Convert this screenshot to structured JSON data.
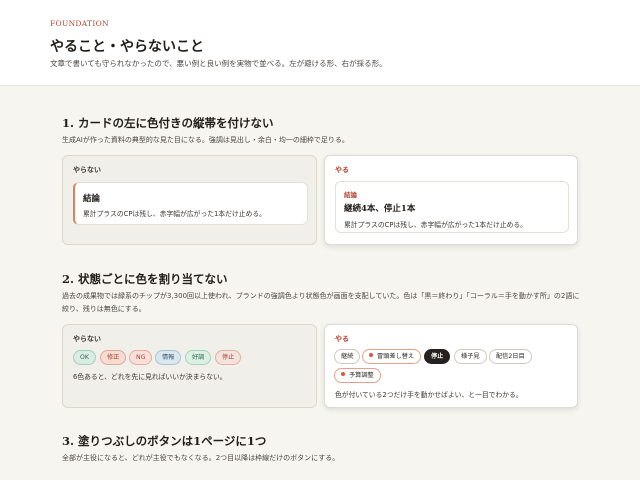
{
  "header": {
    "eyebrow": "FOUNDATION",
    "title": "やること・やらないこと",
    "description": "文章で書いても守られなかったので、悪い例と良い例を実物で並べる。左が避ける形、右が採る形。"
  },
  "sections": [
    {
      "title": "1. カードの左に色付きの縦帯を付けない",
      "description": "生成AIが作った資料の典型的な見た目になる。強調は見出し・余白・均一の細枠で足りる。",
      "bad": {
        "label": "やらない",
        "card_title": "結論",
        "card_body": "累計プラスのCPは残し、赤字幅が広がった1本だけ止める。"
      },
      "good": {
        "label": "やる",
        "kicker": "結論",
        "card_title": "継続4本、停止1本",
        "card_body": "累計プラスのCPは残し、赤字幅が広がった1本だけ止める。"
      }
    },
    {
      "title": "2. 状態ごとに色を割り当てない",
      "description": "過去の成果物では緑系のチップが3,300回以上使われ、ブランドの強調色より状態色が画面を支配していた。色は「黒＝終わり」「コーラル＝手を動かす所」の2語に絞り、残りは無色にする。",
      "bad": {
        "label": "やらない",
        "chips": [
          {
            "text": "OK",
            "bg": "#d9ece3",
            "border": "#a7cdb9",
            "color": "#2d6a4f"
          },
          {
            "text": "修正",
            "bg": "#f7dcd3",
            "border": "#e2a897",
            "color": "#a6432a"
          },
          {
            "text": "NG",
            "bg": "#f9e0da",
            "border": "#e9aaa0",
            "color": "#b53b2e"
          },
          {
            "text": "情報",
            "bg": "#dbe7ef",
            "border": "#a9c3d6",
            "color": "#2e5873"
          },
          {
            "text": "好調",
            "bg": "#dcefe3",
            "border": "#a8d3b7",
            "color": "#2d6a4f"
          },
          {
            "text": "停止",
            "bg": "#f6e2dc",
            "border": "#e3b0a3",
            "color": "#a6432a"
          }
        ],
        "note": "6色あると、どれを先に見ればいいか決まらない。"
      },
      "good": {
        "label": "やる",
        "chips": [
          {
            "text": "継続",
            "style": "neutral",
            "dot": false
          },
          {
            "text": "冒頭差し替え",
            "style": "coral",
            "dot": true
          },
          {
            "text": "停止",
            "style": "dark",
            "dot": false
          },
          {
            "text": "様子見",
            "style": "neutral",
            "dot": false
          },
          {
            "text": "配信2日目",
            "style": "neutral",
            "dot": false
          },
          {
            "text": "予算調整",
            "style": "coral",
            "dot": true
          }
        ],
        "note": "色が付いている2つだけ手を動かせばよい、と一目でわかる。"
      }
    },
    {
      "title": "3. 塗りつぶしのボタンは1ページに1つ",
      "description": "全部が主役になると、どれが主役でもなくなる。2つ目以降は枠線だけのボタンにする。"
    }
  ]
}
